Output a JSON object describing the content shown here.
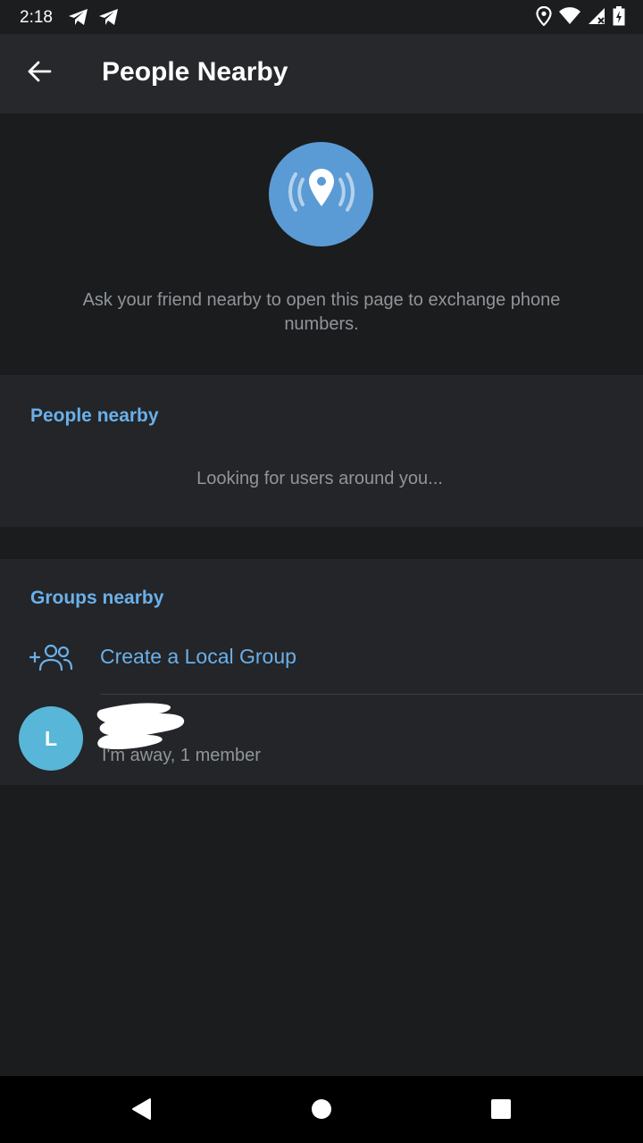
{
  "status_bar": {
    "time": "2:18",
    "left_icons": [
      "telegram-icon",
      "telegram-icon"
    ],
    "right_icons": [
      "location-icon",
      "wifi-icon",
      "signal-icon",
      "battery-icon"
    ]
  },
  "app_bar": {
    "title": "People Nearby",
    "back_icon": "arrow-left-icon"
  },
  "hero": {
    "icon": "location-broadcast-icon",
    "description": "Ask your friend nearby to open this page to exchange phone numbers."
  },
  "people_nearby": {
    "header": "People nearby",
    "status_text": "Looking for users around you..."
  },
  "groups_nearby": {
    "header": "Groups nearby",
    "create_group": {
      "icon": "add-group-icon",
      "label": "Create a Local Group"
    },
    "groups": [
      {
        "avatar_letter": "L",
        "subtitle": "I'm away, 1 member"
      }
    ]
  },
  "colors": {
    "accent": "#6ab0ea",
    "hero_circle": "#5b9bd5",
    "avatar": "#58b6d8",
    "background": "#1b1c1d",
    "section_bg": "#232528",
    "header_bg": "#26282b",
    "muted_text": "#8f959b"
  },
  "nav_bar": {
    "buttons": [
      "back-triangle-icon",
      "home-circle-icon",
      "recents-square-icon"
    ]
  }
}
